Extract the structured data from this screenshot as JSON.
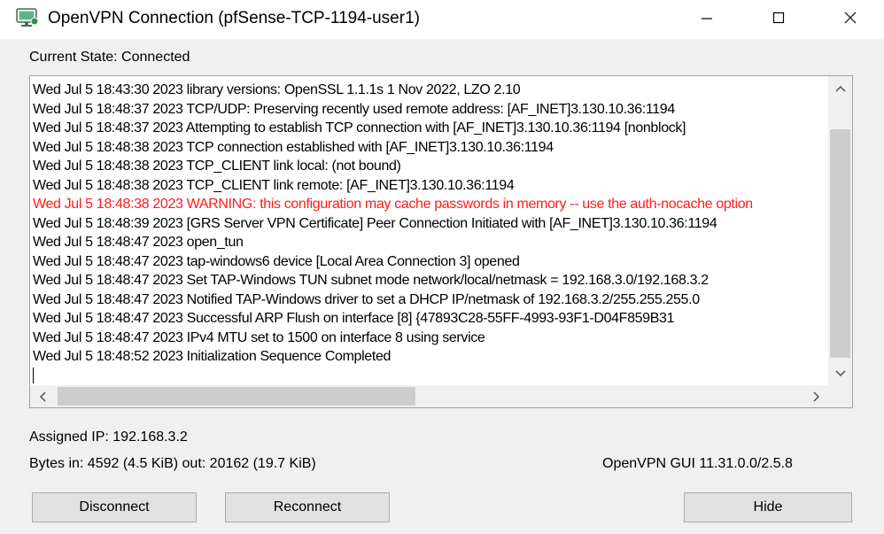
{
  "window": {
    "title": "OpenVPN Connection (pfSense-TCP-1194-user1)",
    "icon": "openvpn-monitor-icon",
    "controls": {
      "minimize": "minimize-icon",
      "maximize": "maximize-icon",
      "close": "close-icon"
    }
  },
  "status": {
    "current_state": "Current State: Connected"
  },
  "log": {
    "lines": [
      "Wed Jul  5 18:43:30 2023 library versions: OpenSSL 1.1.1s  1 Nov 2022, LZO 2.10",
      "Wed Jul  5 18:48:37 2023 TCP/UDP: Preserving recently used remote address: [AF_INET]3.130.10.36:1194",
      "Wed Jul  5 18:48:37 2023 Attempting to establish TCP connection with [AF_INET]3.130.10.36:1194 [nonblock]",
      "Wed Jul  5 18:48:38 2023 TCP connection established with [AF_INET]3.130.10.36:1194",
      "Wed Jul  5 18:48:38 2023 TCP_CLIENT link local: (not bound)",
      "Wed Jul  5 18:48:38 2023 TCP_CLIENT link remote: [AF_INET]3.130.10.36:1194",
      "Wed Jul  5 18:48:38 2023 WARNING: this configuration may cache passwords in memory -- use the auth-nocache option",
      "Wed Jul  5 18:48:39 2023 [GRS Server VPN Certificate] Peer Connection Initiated with [AF_INET]3.130.10.36:1194",
      "Wed Jul  5 18:48:47 2023 open_tun",
      "Wed Jul  5 18:48:47 2023 tap-windows6 device [Local Area Connection 3] opened",
      "Wed Jul  5 18:48:47 2023 Set TAP-Windows TUN subnet mode network/local/netmask = 192.168.3.0/192.168.3.2",
      "Wed Jul  5 18:48:47 2023 Notified TAP-Windows driver to set a DHCP IP/netmask of 192.168.3.2/255.255.255.0",
      "Wed Jul  5 18:48:47 2023 Successful ARP Flush on interface [8] {47893C28-55FF-4993-93F1-D04F859B31",
      "Wed Jul  5 18:48:47 2023 IPv4 MTU set to 1500 on interface 8 using service",
      "Wed Jul  5 18:48:52 2023 Initialization Sequence Completed"
    ],
    "warning_color": "#ff1b1b",
    "scroll_icons": {
      "up": "scroll-up-icon",
      "down": "scroll-down-icon",
      "left": "scroll-left-icon",
      "right": "scroll-right-icon"
    }
  },
  "info": {
    "assigned_ip": "Assigned IP: 192.168.3.2",
    "bytes": "Bytes in: 4592 (4.5 KiB)  out: 20162 (19.7 KiB)",
    "version": "OpenVPN GUI 11.31.0.0/2.5.8"
  },
  "buttons": {
    "disconnect": "Disconnect",
    "reconnect": "Reconnect",
    "hide": "Hide"
  }
}
